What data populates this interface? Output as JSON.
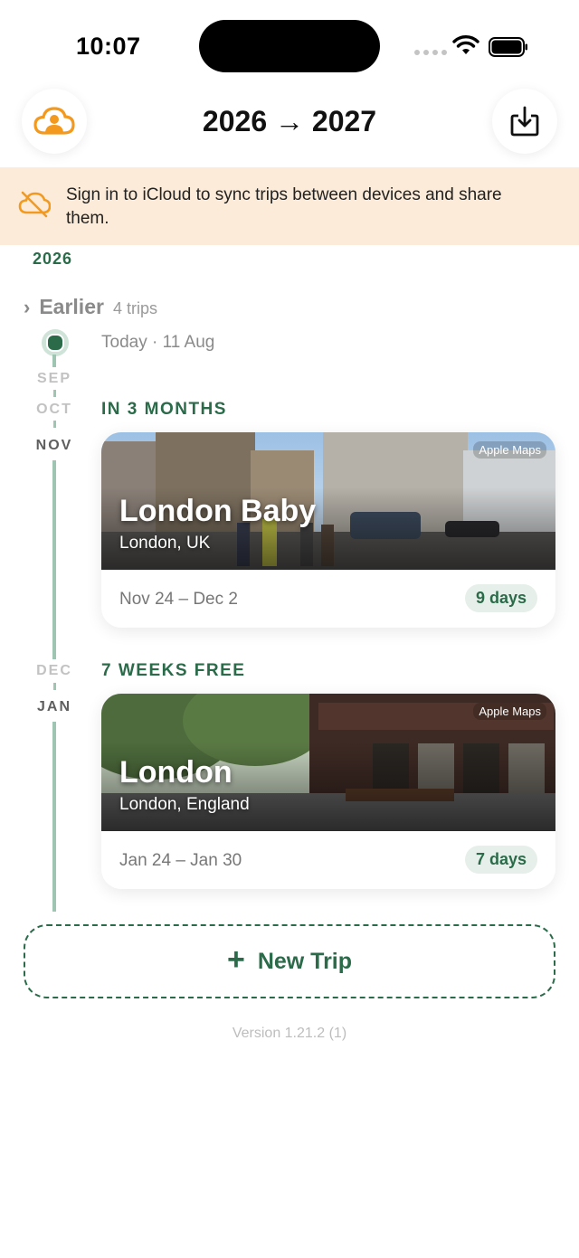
{
  "status_bar": {
    "time": "10:07"
  },
  "header": {
    "title": "2026 → 2027",
    "left_icon": "cloud-person-icon",
    "right_icon": "tray-download-icon",
    "accent": "#f39a1e"
  },
  "banner": {
    "text": "Sign in to iCloud to sync trips between devices and share them.",
    "icon": "cloud-slash-icon",
    "background": "#fcebd8"
  },
  "timeline": {
    "year": "2026",
    "earlier": {
      "label": "Earlier",
      "count": "4 trips"
    },
    "today": "Today · 11 Aug",
    "months": [
      "SEP",
      "OCT",
      "NOV",
      "DEC",
      "JAN"
    ],
    "accent": "#2b6b4a"
  },
  "sections": [
    {
      "heading": "IN 3 MONTHS",
      "trip": {
        "name": "London Baby",
        "place": "London, UK",
        "dates": "Nov 24 – Dec 2",
        "days": "9 days",
        "badge": "Apple Maps"
      }
    },
    {
      "heading": "7 WEEKS FREE",
      "trip": {
        "name": "London",
        "place": "London, England",
        "dates": "Jan 24 – Jan 30",
        "days": "7 days",
        "badge": "Apple Maps"
      }
    }
  ],
  "new_trip": {
    "label": "New Trip"
  },
  "footer": {
    "version": "Version 1.21.2 (1)"
  }
}
